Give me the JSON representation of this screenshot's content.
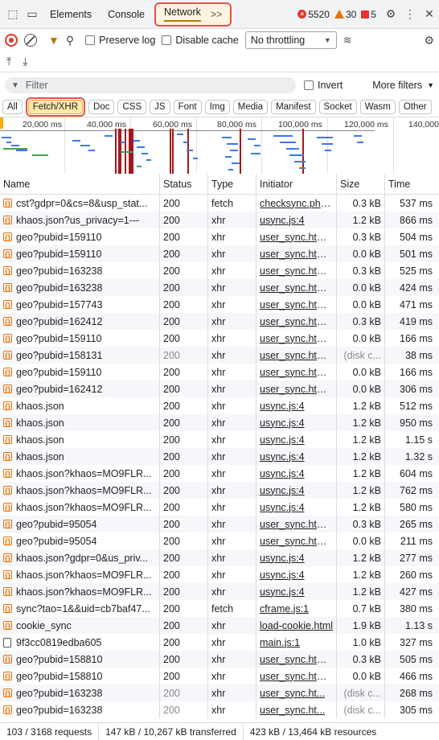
{
  "tabbar": {
    "tabs": [
      "Elements",
      "Console",
      "Network"
    ],
    "more": ">>",
    "errors": "5520",
    "warnings": "30",
    "issues": "5"
  },
  "toolbar": {
    "preserve_log": "Preserve log",
    "disable_cache": "Disable cache",
    "throttling": "No throttling"
  },
  "filter": {
    "placeholder": "Filter",
    "invert": "Invert",
    "more_filters": "More filters"
  },
  "types": [
    "All",
    "Fetch/XHR",
    "Doc",
    "CSS",
    "JS",
    "Font",
    "Img",
    "Media",
    "Manifest",
    "Socket",
    "Wasm",
    "Other"
  ],
  "overview": {
    "ticks": [
      "20,000 ms",
      "40,000 ms",
      "60,000 ms",
      "80,000 ms",
      "100,000 ms",
      "120,000 ms",
      "140,000"
    ]
  },
  "table": {
    "headers": [
      "Name",
      "Status",
      "Type",
      "Initiator",
      "Size",
      "Time"
    ],
    "rows": [
      {
        "name": "cst?gdpr=0&cs=8&usp_stat...",
        "status": "200",
        "type": "fetch",
        "initiator": "checksync.php?v",
        "size": "0.3 kB",
        "time": "537 ms"
      },
      {
        "name": "khaos.json?us_privacy=1---",
        "status": "200",
        "type": "xhr",
        "initiator": "usync.js:4",
        "size": "1.2 kB",
        "time": "866 ms"
      },
      {
        "name": "geo?pubid=159110",
        "status": "200",
        "type": "xhr",
        "initiator": "user_sync.html?p",
        "size": "0.3 kB",
        "time": "504 ms"
      },
      {
        "name": "geo?pubid=159110",
        "status": "200",
        "type": "xhr",
        "initiator": "user_sync.html?p",
        "size": "0.0 kB",
        "time": "501 ms"
      },
      {
        "name": "geo?pubid=163238",
        "status": "200",
        "type": "xhr",
        "initiator": "user_sync.html?k",
        "size": "0.3 kB",
        "time": "525 ms"
      },
      {
        "name": "geo?pubid=163238",
        "status": "200",
        "type": "xhr",
        "initiator": "user_sync.html?k",
        "size": "0.0 kB",
        "time": "424 ms"
      },
      {
        "name": "geo?pubid=157743",
        "status": "200",
        "type": "xhr",
        "initiator": "user_sync.html?p",
        "size": "0.0 kB",
        "time": "471 ms"
      },
      {
        "name": "geo?pubid=162412",
        "status": "200",
        "type": "xhr",
        "initiator": "user_sync.html?p",
        "size": "0.3 kB",
        "time": "419 ms"
      },
      {
        "name": "geo?pubid=159110",
        "status": "200",
        "type": "xhr",
        "initiator": "user_sync.html?p",
        "size": "0.0 kB",
        "time": "166 ms"
      },
      {
        "name": "geo?pubid=158131",
        "status": "200",
        "type": "xhr",
        "initiator": "user_sync.html?k",
        "size": "(disk c...",
        "time": "38 ms",
        "dim": true
      },
      {
        "name": "geo?pubid=159110",
        "status": "200",
        "type": "xhr",
        "initiator": "user_sync.html?p",
        "size": "0.0 kB",
        "time": "166 ms"
      },
      {
        "name": "geo?pubid=162412",
        "status": "200",
        "type": "xhr",
        "initiator": "user_sync.html?p",
        "size": "0.0 kB",
        "time": "306 ms"
      },
      {
        "name": "khaos.json",
        "status": "200",
        "type": "xhr",
        "initiator": "usync.js:4",
        "size": "1.2 kB",
        "time": "512 ms"
      },
      {
        "name": "khaos.json",
        "status": "200",
        "type": "xhr",
        "initiator": "usync.js:4",
        "size": "1.2 kB",
        "time": "950 ms"
      },
      {
        "name": "khaos.json",
        "status": "200",
        "type": "xhr",
        "initiator": "usync.js:4",
        "size": "1.2 kB",
        "time": "1.15 s"
      },
      {
        "name": "khaos.json",
        "status": "200",
        "type": "xhr",
        "initiator": "usync.js:4",
        "size": "1.2 kB",
        "time": "1.32 s"
      },
      {
        "name": "khaos.json?khaos=MO9FLR...",
        "status": "200",
        "type": "xhr",
        "initiator": "usync.js:4",
        "size": "1.2 kB",
        "time": "604 ms"
      },
      {
        "name": "khaos.json?khaos=MO9FLR...",
        "status": "200",
        "type": "xhr",
        "initiator": "usync.js:4",
        "size": "1.2 kB",
        "time": "762 ms"
      },
      {
        "name": "khaos.json?khaos=MO9FLR...",
        "status": "200",
        "type": "xhr",
        "initiator": "usync.js:4",
        "size": "1.2 kB",
        "time": "580 ms"
      },
      {
        "name": "geo?pubid=95054",
        "status": "200",
        "type": "xhr",
        "initiator": "user_sync.html?p",
        "size": "0.3 kB",
        "time": "265 ms"
      },
      {
        "name": "geo?pubid=95054",
        "status": "200",
        "type": "xhr",
        "initiator": "user_sync.html?p",
        "size": "0.0 kB",
        "time": "211 ms"
      },
      {
        "name": "khaos.json?gdpr=0&us_priv...",
        "status": "200",
        "type": "xhr",
        "initiator": "usync.js:4",
        "size": "1.2 kB",
        "time": "277 ms"
      },
      {
        "name": "khaos.json?khaos=MO9FLR...",
        "status": "200",
        "type": "xhr",
        "initiator": "usync.js:4",
        "size": "1.2 kB",
        "time": "260 ms"
      },
      {
        "name": "khaos.json?khaos=MO9FLR...",
        "status": "200",
        "type": "xhr",
        "initiator": "usync.js:4",
        "size": "1.2 kB",
        "time": "427 ms"
      },
      {
        "name": "sync?tao=1&&uid=cb7baf47...",
        "status": "200",
        "type": "fetch",
        "initiator": "cframe.js:1",
        "size": "0.7 kB",
        "time": "380 ms"
      },
      {
        "name": "cookie_sync",
        "status": "200",
        "type": "xhr",
        "initiator": "load-cookie.html",
        "size": "1.9 kB",
        "time": "1.13 s"
      },
      {
        "name": "9f3cc0819edba605",
        "status": "200",
        "type": "xhr",
        "initiator": "main.js:1",
        "size": "1.0 kB",
        "time": "327 ms",
        "doc": true
      },
      {
        "name": "geo?pubid=158810",
        "status": "200",
        "type": "xhr",
        "initiator": "user_sync.html?p",
        "size": "0.3 kB",
        "time": "505 ms"
      },
      {
        "name": "geo?pubid=158810",
        "status": "200",
        "type": "xhr",
        "initiator": "user_sync.html?p",
        "size": "0.0 kB",
        "time": "466 ms"
      },
      {
        "name": "geo?pubid=163238",
        "status": "200",
        "type": "xhr",
        "initiator": "user_sync.ht...",
        "size": "(disk c...",
        "time": "268 ms",
        "dim": true
      },
      {
        "name": "geo?pubid=163238",
        "status": "200",
        "type": "xhr",
        "initiator": "user_sync.ht...",
        "size": "(disk c...",
        "time": "305 ms",
        "dim": true
      }
    ]
  },
  "status": {
    "requests": "103 / 3168 requests",
    "transferred": "147 kB / 10,267 kB transferred",
    "resources": "423 kB / 13,464 kB resources"
  }
}
